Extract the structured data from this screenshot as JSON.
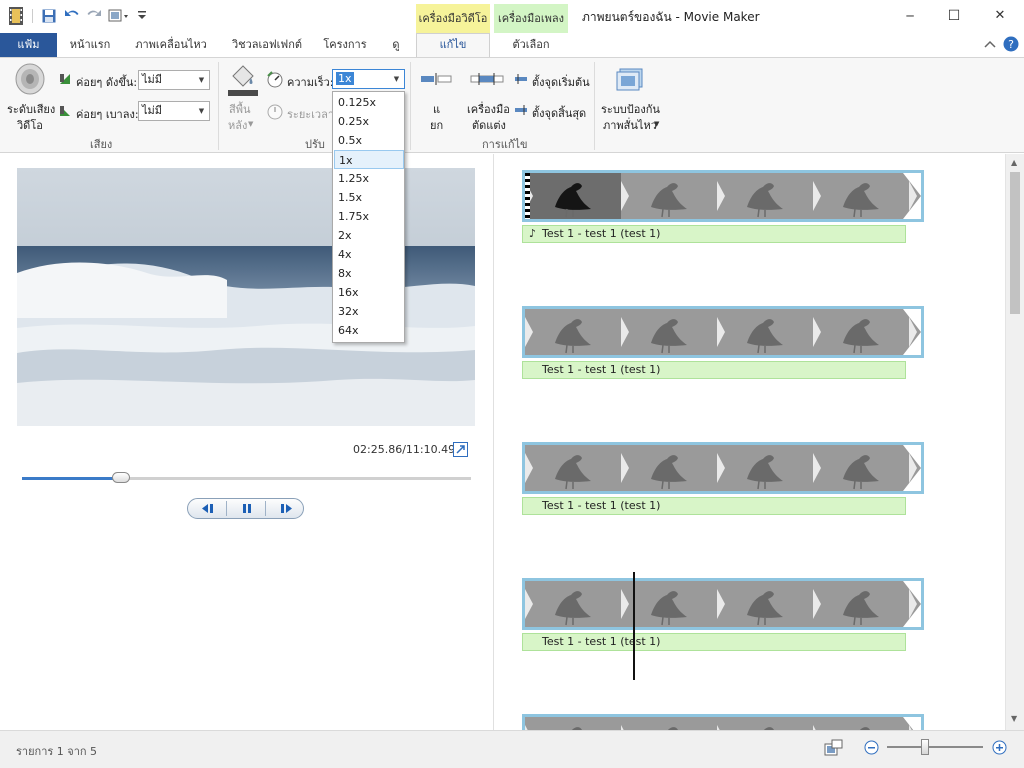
{
  "window": {
    "title": "ภาพยนตร์ของฉัน - Movie Maker",
    "minimize": "─",
    "maximize": "☐",
    "close": "✕"
  },
  "qat": {
    "icons": [
      "app-film-icon",
      "save-icon",
      "undo-icon",
      "redo-icon",
      "snapshot-icon",
      "customize-qat-icon"
    ]
  },
  "tabs": {
    "file": "แฟ้ม",
    "home": "หน้าแรก",
    "animations": "ภาพเคลื่อนไหว",
    "visual_effects": "วิชวลเอฟเฟกต์",
    "project": "โครงการ",
    "view": "ดู",
    "video_tools_header": "เครื่องมือวิดีโอ",
    "music_tools_header": "เครื่องมือเพลง",
    "edit": "แก้ไข",
    "options": "ตัวเลือก"
  },
  "ribbon": {
    "audio": {
      "volume_line1": "ระดับเสียง",
      "volume_line2": "วิดีโอ",
      "fade_in_label": "ค่อยๆ ดังขึ้น:",
      "fade_in_value": "ไม่มี",
      "fade_out_label": "ค่อยๆ เบาลง:",
      "fade_out_value": "ไม่มี",
      "group": "เสียง"
    },
    "adjust": {
      "bg_color_line1": "สีพื้น",
      "bg_color_line2": "หลัง",
      "speed_label": "ความเร็ว:",
      "speed_value": "1x",
      "duration_label": "ระยะเวลา:",
      "group": "ปรับ"
    },
    "editing": {
      "split_line1": "แ",
      "split_line2": "ยก",
      "trim_line1": "เครื่องมือ",
      "trim_line2": "ตัดแต่ง",
      "set_start": "ตั้งจุดเริ่มต้น",
      "set_end": "ตั้งจุดสิ้นสุด",
      "group": "การแก้ไข"
    },
    "stabilization": {
      "line1": "ระบบป้องกัน",
      "line2": "ภาพสั่นไหว"
    }
  },
  "speed_options": [
    "0.125x",
    "0.25x",
    "0.5x",
    "1x",
    "1.25x",
    "1.5x",
    "1.75x",
    "2x",
    "4x",
    "8x",
    "16x",
    "32x",
    "64x"
  ],
  "speed_selected": "1x",
  "preview": {
    "timecode": "02:25.86/11:10.49",
    "seek_progress": 0.22
  },
  "storyboard": {
    "clips": [
      {
        "caption": "Test 1 - test 1 (test 1)"
      },
      {
        "caption": "Test 1 - test 1 (test 1)"
      },
      {
        "caption": "Test 1 - test 1 (test 1)"
      },
      {
        "caption": "Test 1 - test 1 (test 1)"
      }
    ]
  },
  "status": {
    "item_count": "รายการ 1 จาก 5",
    "zoom_level": 0.4
  },
  "colors": {
    "file_tab": "#2a579a",
    "video_tools_ctx": "#f6f39a",
    "music_tools_ctx": "#d3f5c5",
    "clip_border": "#8ec5e0",
    "caption_bg": "#d8f5c8"
  }
}
